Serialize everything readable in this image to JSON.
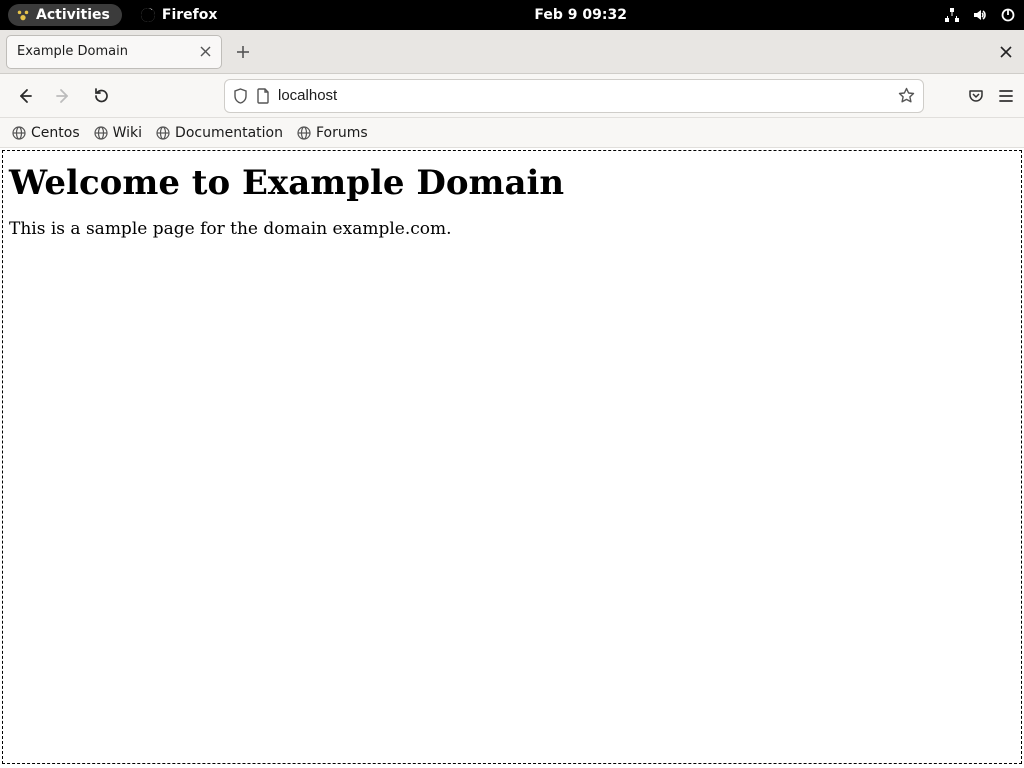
{
  "panel": {
    "activities": "Activities",
    "app_name": "Firefox",
    "clock": "Feb 9  09:32"
  },
  "tabs": {
    "active": {
      "title": "Example Domain"
    }
  },
  "urlbar": {
    "value": "localhost"
  },
  "bookmarks": [
    {
      "label": "Centos"
    },
    {
      "label": "Wiki"
    },
    {
      "label": "Documentation"
    },
    {
      "label": "Forums"
    }
  ],
  "page": {
    "heading": "Welcome to Example Domain",
    "paragraph": "This is a sample page for the domain example.com."
  }
}
